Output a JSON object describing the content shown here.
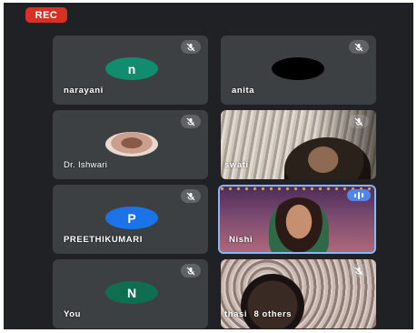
{
  "recording": {
    "label": "REC",
    "color": "#d93025"
  },
  "participants": [
    {
      "name": "narayani",
      "initial": "n",
      "avatar_color": "#128c6e",
      "muted": true
    },
    {
      "name": "anita",
      "initial": "",
      "avatar_color": "#000000",
      "muted": true
    },
    {
      "name": "Dr. Ishwari",
      "avatar": "photo",
      "muted": true
    },
    {
      "name": "swati",
      "video": true,
      "muted": true
    },
    {
      "name": "PREETHIKUMARI",
      "initial": "P",
      "avatar_color": "#1a73e8",
      "muted": true
    },
    {
      "name": "Nishi",
      "video": true,
      "speaking": true,
      "muted": false
    },
    {
      "name": "You",
      "initial": "N",
      "avatar_color": "#0f6e4f",
      "muted": true
    },
    {
      "name": "thasi",
      "others_label": "8 others",
      "video": true,
      "muted": true
    }
  ],
  "icons": {
    "mute": "mic-off-icon",
    "speaking": "audio-level-icon"
  },
  "colors": {
    "background": "#202124",
    "tile": "#3c4043",
    "active_speaker_border": "#8ab4f8"
  }
}
